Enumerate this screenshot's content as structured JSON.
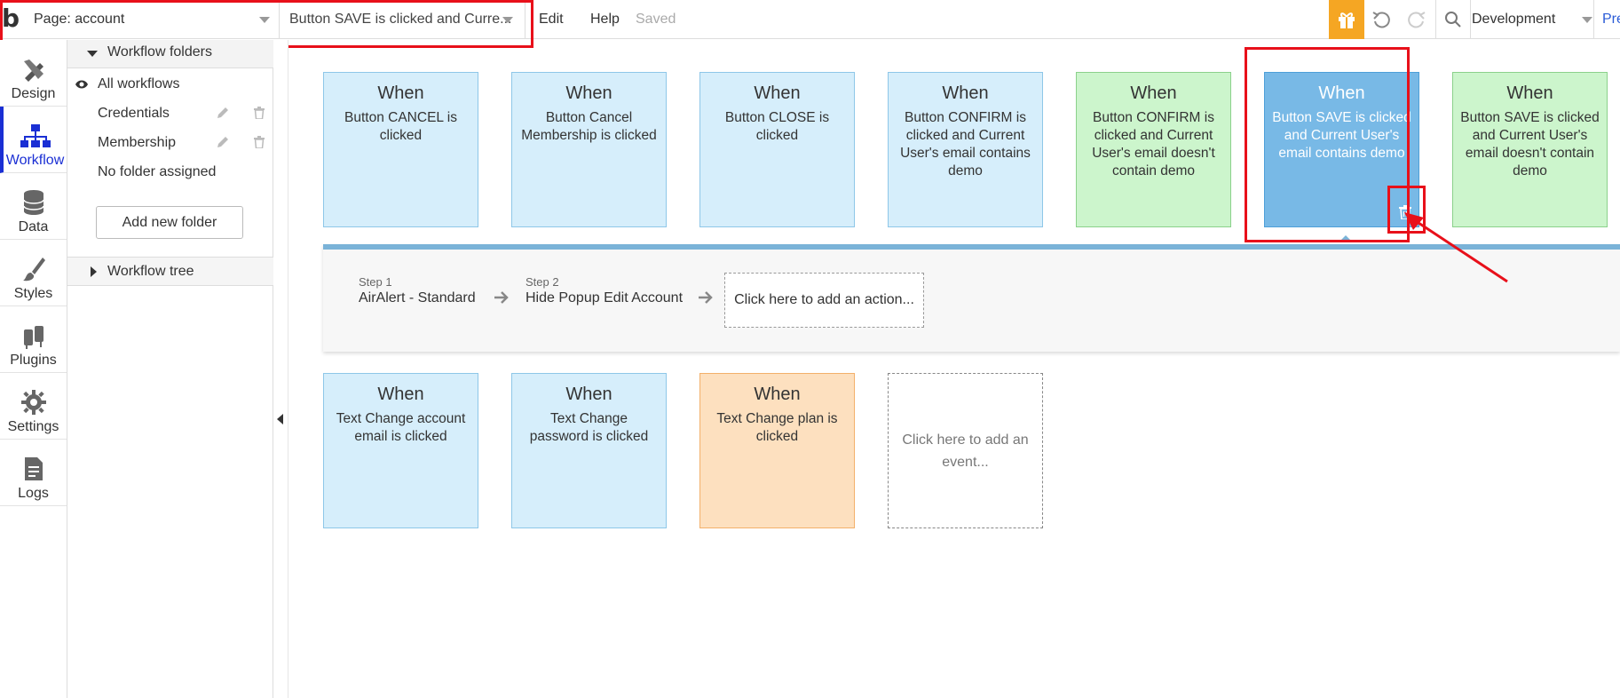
{
  "topbar": {
    "page_select": "Page: account",
    "workflow_select": "Button SAVE is clicked and Curre...",
    "menu": [
      "Edit",
      "Help"
    ],
    "status": "Saved",
    "environment": "Development",
    "preview": "Pre"
  },
  "leftnav": {
    "items": [
      {
        "label": "Design",
        "icon": "design-icon"
      },
      {
        "label": "Workflow",
        "icon": "workflow-icon",
        "active": true
      },
      {
        "label": "Data",
        "icon": "database-icon"
      },
      {
        "label": "Styles",
        "icon": "brush-icon"
      },
      {
        "label": "Plugins",
        "icon": "plug-icon"
      },
      {
        "label": "Settings",
        "icon": "gear-icon"
      },
      {
        "label": "Logs",
        "icon": "document-icon"
      }
    ]
  },
  "folders": {
    "header": "Workflow folders",
    "all": "All workflows",
    "items": [
      "Credentials",
      "Membership"
    ],
    "unassigned": "No folder assigned",
    "add_button": "Add new folder",
    "tree": "Workflow tree"
  },
  "events_row1": [
    {
      "when": "When",
      "desc": "Button CANCEL is clicked",
      "color": "blue"
    },
    {
      "when": "When",
      "desc": "Button Cancel Membership is clicked",
      "color": "blue"
    },
    {
      "when": "When",
      "desc": "Button CLOSE is clicked",
      "color": "blue"
    },
    {
      "when": "When",
      "desc": "Button CONFIRM is clicked and Current User's email contains demo",
      "color": "blue"
    },
    {
      "when": "When",
      "desc": "Button CONFIRM is clicked and Current User's email doesn't contain demo",
      "color": "green"
    },
    {
      "when": "When",
      "desc": "Button SAVE is clicked and Current User's email contains demo",
      "color": "selected"
    },
    {
      "when": "When",
      "desc": "Button SAVE is clicked and Current User's email doesn't contain demo",
      "color": "green"
    }
  ],
  "steps": [
    {
      "num": "Step 1",
      "name": "AirAlert - Standard"
    },
    {
      "num": "Step 2",
      "name": "Hide Popup Edit Account"
    }
  ],
  "add_action": "Click here to add an action...",
  "events_row2": [
    {
      "when": "When",
      "desc": "Text Change account email is clicked",
      "color": "blue"
    },
    {
      "when": "When",
      "desc": "Text Change password is clicked",
      "color": "blue"
    },
    {
      "when": "When",
      "desc": "Text Change plan is clicked",
      "color": "orange"
    }
  ],
  "add_event": "Click here to add an event...",
  "colors": {
    "highlight": "#e8101a",
    "selected": "#78b9e6",
    "accent": "#1a2fd4"
  }
}
